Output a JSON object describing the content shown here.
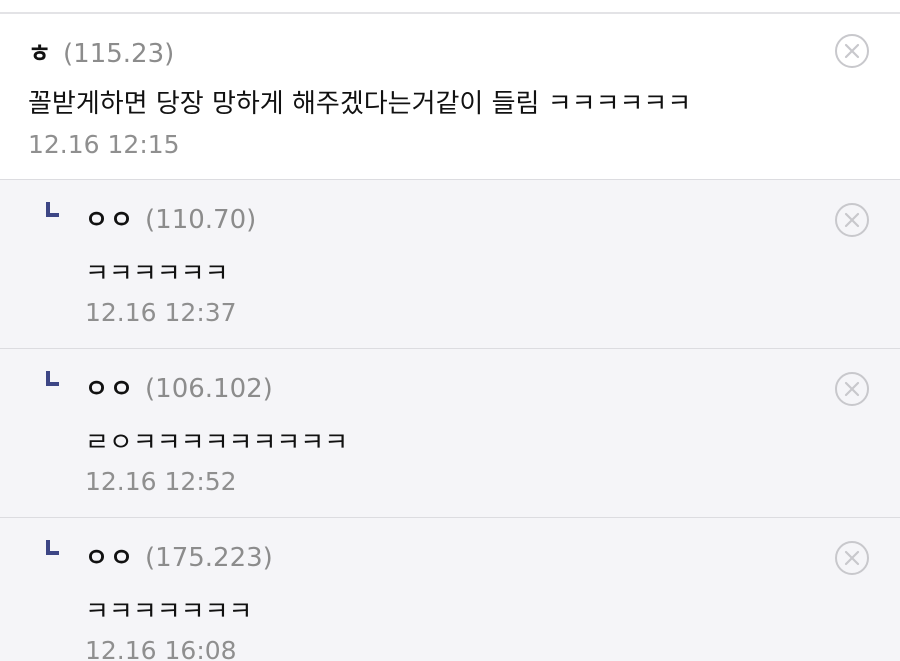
{
  "comments": {
    "main": {
      "nickname": "ㅎ",
      "ip": "(115.23)",
      "text": "꼴받게하면 당장 망하게 해주겠다는거같이 들림 ㅋㅋㅋㅋㅋㅋ",
      "time": "12.16 12:15"
    },
    "replies": [
      {
        "nickname": "ㅇㅇ",
        "ip": "(110.70)",
        "text": "ㅋㅋㅋㅋㅋㅋ",
        "time": "12.16 12:37"
      },
      {
        "nickname": "ㅇㅇ",
        "ip": "(106.102)",
        "text": "ㄹㅇㅋㅋㅋㅋㅋㅋㅋㅋㅋ",
        "time": "12.16 12:52"
      },
      {
        "nickname": "ㅇㅇ",
        "ip": "(175.223)",
        "text": "ㅋㅋㅋㅋㅋㅋㅋ",
        "time": "12.16 16:08"
      }
    ]
  },
  "icons": {
    "reply_marker": "reply-arrow-icon",
    "delete": "close-circle-icon"
  },
  "colors": {
    "reply_background": "#f5f5f8",
    "reply_marker": "#3d4685",
    "ip_text": "#8c8c8c",
    "timestamp_text": "#8f8f8f",
    "divider": "#dcdce0"
  }
}
